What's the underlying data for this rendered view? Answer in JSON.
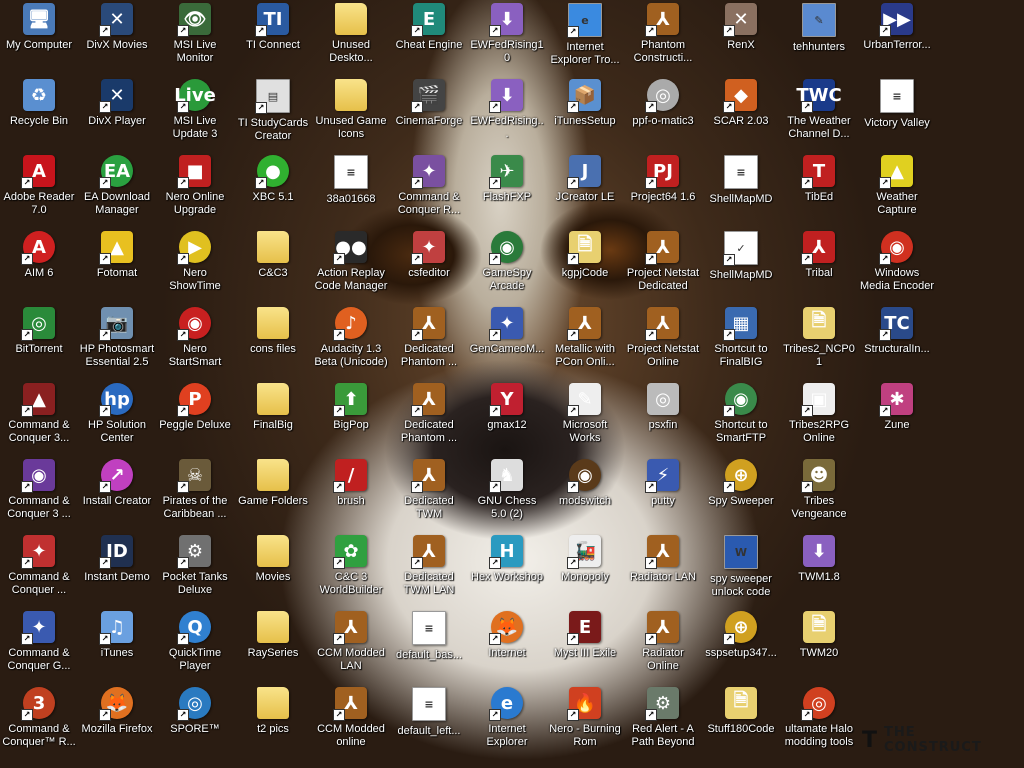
{
  "desktop": {
    "icons": [
      {
        "label": "My Computer",
        "glyph": "🖥",
        "bg": "#4a7ab8",
        "type": "app",
        "shortcut": false
      },
      {
        "label": "Recycle Bin",
        "glyph": "♻",
        "bg": "#5a8fd0",
        "type": "app",
        "shortcut": false
      },
      {
        "label": "Adobe Reader 7.0",
        "glyph": "A",
        "bg": "#c8141c",
        "type": "app",
        "shortcut": true
      },
      {
        "label": "AIM 6",
        "glyph": "A",
        "bg": "#d02020",
        "type": "round",
        "shortcut": true
      },
      {
        "label": "BitTorrent",
        "glyph": "◎",
        "bg": "#2a8a3a",
        "type": "app",
        "shortcut": true
      },
      {
        "label": "Command & Conquer 3...",
        "glyph": "▲",
        "bg": "#8a2020",
        "type": "app",
        "shortcut": true
      },
      {
        "label": "Command & Conquer 3 ...",
        "glyph": "◉",
        "bg": "#6a3a9a",
        "type": "app",
        "shortcut": true
      },
      {
        "label": "Command & Conquer ...",
        "glyph": "✦",
        "bg": "#c03030",
        "type": "app",
        "shortcut": true
      },
      {
        "label": "Command & Conquer G...",
        "glyph": "✦",
        "bg": "#3a5ab0",
        "type": "app",
        "shortcut": true
      },
      {
        "label": "Command & Conquer™ R...",
        "glyph": "3",
        "bg": "#c04020",
        "type": "round",
        "shortcut": true
      },
      {
        "label": "DivX Movies",
        "glyph": "✕",
        "bg": "#2a4a7a",
        "type": "app",
        "shortcut": true
      },
      {
        "label": "DivX Player",
        "glyph": "✕",
        "bg": "#1a3a6a",
        "type": "app",
        "shortcut": true
      },
      {
        "label": "EA Download Manager",
        "glyph": "EA",
        "bg": "#2aa040",
        "type": "round",
        "shortcut": true
      },
      {
        "label": "Fotomat",
        "glyph": "▲",
        "bg": "#e8c020",
        "type": "app",
        "shortcut": true
      },
      {
        "label": "HP Photosmart Essential 2.5",
        "glyph": "📷",
        "bg": "#7090b0",
        "type": "app",
        "shortcut": true
      },
      {
        "label": "HP Solution Center",
        "glyph": "hp",
        "bg": "#2a6ac0",
        "type": "round",
        "shortcut": true
      },
      {
        "label": "Install Creator",
        "glyph": "↗",
        "bg": "#c040c0",
        "type": "round",
        "shortcut": true
      },
      {
        "label": "Instant Demo",
        "glyph": "ID",
        "bg": "#203050",
        "type": "app",
        "shortcut": true
      },
      {
        "label": "iTunes",
        "glyph": "♫",
        "bg": "#6aa0e0",
        "type": "app",
        "shortcut": true
      },
      {
        "label": "Mozilla Firefox",
        "glyph": "🦊",
        "bg": "#e07020",
        "type": "round",
        "shortcut": true
      },
      {
        "label": "MSI Live Monitor",
        "glyph": "👁",
        "bg": "#3a6a3a",
        "type": "app",
        "shortcut": true
      },
      {
        "label": "MSI Live Update 3",
        "glyph": "Live",
        "bg": "#2a9a3a",
        "type": "round",
        "shortcut": true
      },
      {
        "label": "Nero Online Upgrade",
        "glyph": "■",
        "bg": "#c02020",
        "type": "app",
        "shortcut": true
      },
      {
        "label": "Nero ShowTime",
        "glyph": "▶",
        "bg": "#e0c020",
        "type": "round",
        "shortcut": true
      },
      {
        "label": "Nero StartSmart",
        "glyph": "◉",
        "bg": "#c82020",
        "type": "round",
        "shortcut": true
      },
      {
        "label": "Peggle Deluxe",
        "glyph": "P",
        "bg": "#e04020",
        "type": "round",
        "shortcut": true
      },
      {
        "label": "Pirates of the Caribbean ...",
        "glyph": "☠",
        "bg": "#6a5a3a",
        "type": "app",
        "shortcut": true
      },
      {
        "label": "Pocket Tanks Deluxe",
        "glyph": "⚙",
        "bg": "#707070",
        "type": "app",
        "shortcut": true
      },
      {
        "label": "QuickTime Player",
        "glyph": "Q",
        "bg": "#3080d0",
        "type": "round",
        "shortcut": true
      },
      {
        "label": "SPORE™",
        "glyph": "◎",
        "bg": "#2a7ac0",
        "type": "round",
        "shortcut": true
      },
      {
        "label": "TI Connect",
        "glyph": "TI",
        "bg": "#2a5aa0",
        "type": "app",
        "shortcut": true
      },
      {
        "label": "TI StudyCards Creator",
        "glyph": "▤",
        "bg": "#e0e0e0",
        "type": "doc",
        "shortcut": true
      },
      {
        "label": "XBC 5.1",
        "glyph": "●",
        "bg": "#30b030",
        "type": "round",
        "shortcut": true
      },
      {
        "label": "C&C3",
        "glyph": "",
        "bg": "",
        "type": "folder",
        "shortcut": false
      },
      {
        "label": "cons files",
        "glyph": "",
        "bg": "",
        "type": "folder",
        "shortcut": false
      },
      {
        "label": "FinalBig",
        "glyph": "",
        "bg": "",
        "type": "folder",
        "shortcut": false
      },
      {
        "label": "Game Folders",
        "glyph": "",
        "bg": "",
        "type": "folder",
        "shortcut": false
      },
      {
        "label": "Movies",
        "glyph": "",
        "bg": "",
        "type": "folder",
        "shortcut": false
      },
      {
        "label": "RaySeries",
        "glyph": "",
        "bg": "",
        "type": "folder",
        "shortcut": false
      },
      {
        "label": "t2 pics",
        "glyph": "",
        "bg": "",
        "type": "folder",
        "shortcut": false
      },
      {
        "label": "Unused Deskto...",
        "glyph": "",
        "bg": "",
        "type": "folder",
        "shortcut": false
      },
      {
        "label": "Unused Game Icons",
        "glyph": "",
        "bg": "",
        "type": "folder",
        "shortcut": false
      },
      {
        "label": "38a01668",
        "glyph": "≡",
        "bg": "#fff",
        "type": "doc",
        "shortcut": false
      },
      {
        "label": "Action Replay Code Manager",
        "glyph": "●●",
        "bg": "#2a2a2a",
        "type": "app",
        "shortcut": true
      },
      {
        "label": "Audacity 1.3 Beta (Unicode)",
        "glyph": "♪",
        "bg": "#e06020",
        "type": "round",
        "shortcut": true
      },
      {
        "label": "BigPop",
        "glyph": "⬆",
        "bg": "#3a9a3a",
        "type": "app",
        "shortcut": true
      },
      {
        "label": "brush",
        "glyph": "/",
        "bg": "#c02020",
        "type": "app",
        "shortcut": true
      },
      {
        "label": "C&C 3 WorldBuilder",
        "glyph": "✿",
        "bg": "#30a040",
        "type": "app",
        "shortcut": true
      },
      {
        "label": "CCM Modded LAN",
        "glyph": "⅄",
        "bg": "#a06020",
        "type": "app",
        "shortcut": true
      },
      {
        "label": "CCM Modded online",
        "glyph": "⅄",
        "bg": "#a06020",
        "type": "app",
        "shortcut": true
      },
      {
        "label": "Cheat Engine",
        "glyph": "E",
        "bg": "#208a7a",
        "type": "app",
        "shortcut": true
      },
      {
        "label": "CinemaForge",
        "glyph": "🎬",
        "bg": "#444",
        "type": "app",
        "shortcut": true
      },
      {
        "label": "Command & Conquer R...",
        "glyph": "✦",
        "bg": "#7a50a0",
        "type": "app",
        "shortcut": true
      },
      {
        "label": "csfeditor",
        "glyph": "✦",
        "bg": "#c04040",
        "type": "app",
        "shortcut": true
      },
      {
        "label": "Dedicated Phantom ...",
        "glyph": "⅄",
        "bg": "#a06020",
        "type": "app",
        "shortcut": true
      },
      {
        "label": "Dedicated Phantom ...",
        "glyph": "⅄",
        "bg": "#a06020",
        "type": "app",
        "shortcut": true
      },
      {
        "label": "Dedicated TWM",
        "glyph": "⅄",
        "bg": "#a06020",
        "type": "app",
        "shortcut": true
      },
      {
        "label": "Dedicated TWM LAN",
        "glyph": "⅄",
        "bg": "#a06020",
        "type": "app",
        "shortcut": true
      },
      {
        "label": "default_bas...",
        "glyph": "≡",
        "bg": "#fff",
        "type": "doc",
        "shortcut": false
      },
      {
        "label": "default_left...",
        "glyph": "≡",
        "bg": "#fff",
        "type": "doc",
        "shortcut": false
      },
      {
        "label": "EWFedRising10",
        "glyph": "⬇",
        "bg": "#8a60c0",
        "type": "app",
        "shortcut": true
      },
      {
        "label": "EWFedRising...",
        "glyph": "⬇",
        "bg": "#8a60c0",
        "type": "app",
        "shortcut": true
      },
      {
        "label": "FlashFXP",
        "glyph": "✈",
        "bg": "#3a8a4a",
        "type": "app",
        "shortcut": true
      },
      {
        "label": "GameSpy Arcade",
        "glyph": "◉",
        "bg": "#2a7a3a",
        "type": "round",
        "shortcut": true
      },
      {
        "label": "GenCameoM...",
        "glyph": "✦",
        "bg": "#3a5ab0",
        "type": "app",
        "shortcut": true
      },
      {
        "label": "gmax12",
        "glyph": "Y",
        "bg": "#c02030",
        "type": "app",
        "shortcut": true
      },
      {
        "label": "GNU Chess 5.0 (2)",
        "glyph": "♞",
        "bg": "#ddd",
        "type": "app",
        "shortcut": true
      },
      {
        "label": "Hex Workshop",
        "glyph": "H",
        "bg": "#2a9ac0",
        "type": "app",
        "shortcut": true
      },
      {
        "label": "Internet",
        "glyph": "🦊",
        "bg": "#e07020",
        "type": "round",
        "shortcut": true
      },
      {
        "label": "Internet Explorer",
        "glyph": "e",
        "bg": "#2a7ad0",
        "type": "round",
        "shortcut": true
      },
      {
        "label": "Internet Explorer Tro...",
        "glyph": "e",
        "bg": "#3a8ae0",
        "type": "doc",
        "shortcut": true
      },
      {
        "label": "iTunesSetup",
        "glyph": "📦",
        "bg": "#5a90d0",
        "type": "app",
        "shortcut": true
      },
      {
        "label": "JCreator LE",
        "glyph": "J",
        "bg": "#4a70b0",
        "type": "app",
        "shortcut": true
      },
      {
        "label": "kgpjCode",
        "glyph": "🗎",
        "bg": "#e8d070",
        "type": "app",
        "shortcut": true
      },
      {
        "label": "Metallic with PCon Onli...",
        "glyph": "⅄",
        "bg": "#a06020",
        "type": "app",
        "shortcut": true
      },
      {
        "label": "Microsoft Works",
        "glyph": "✎",
        "bg": "#eee",
        "type": "app",
        "shortcut": true
      },
      {
        "label": "modswitch",
        "glyph": "◉",
        "bg": "#5a3a1a",
        "type": "round",
        "shortcut": true
      },
      {
        "label": "Monopoly",
        "glyph": "🚂",
        "bg": "#eee",
        "type": "app",
        "shortcut": true
      },
      {
        "label": "Myst III Exile",
        "glyph": "E",
        "bg": "#7a1a1a",
        "type": "app",
        "shortcut": true
      },
      {
        "label": "Nero - Burning Rom",
        "glyph": "🔥",
        "bg": "#d04020",
        "type": "app",
        "shortcut": true
      },
      {
        "label": "Phantom Constructi...",
        "glyph": "⅄",
        "bg": "#a06020",
        "type": "app",
        "shortcut": true
      },
      {
        "label": "ppf-o-matic3",
        "glyph": "◎",
        "bg": "#aaa",
        "type": "round",
        "shortcut": true
      },
      {
        "label": "Project64 1.6",
        "glyph": "PJ",
        "bg": "#c02020",
        "type": "app",
        "shortcut": true
      },
      {
        "label": "Project Netstat Dedicated",
        "glyph": "⅄",
        "bg": "#a06020",
        "type": "app",
        "shortcut": true
      },
      {
        "label": "Project Netstat Online",
        "glyph": "⅄",
        "bg": "#a06020",
        "type": "app",
        "shortcut": true
      },
      {
        "label": "psxfin",
        "glyph": "◎",
        "bg": "#bbb",
        "type": "app",
        "shortcut": false
      },
      {
        "label": "putty",
        "glyph": "⚡",
        "bg": "#3a5ab0",
        "type": "app",
        "shortcut": true
      },
      {
        "label": "Radiator LAN",
        "glyph": "⅄",
        "bg": "#a06020",
        "type": "app",
        "shortcut": true
      },
      {
        "label": "Radiator Online",
        "glyph": "⅄",
        "bg": "#a06020",
        "type": "app",
        "shortcut": true
      },
      {
        "label": "Red Alert - A Path Beyond",
        "glyph": "⚙",
        "bg": "#6a7a6a",
        "type": "app",
        "shortcut": true
      },
      {
        "label": "RenX",
        "glyph": "✕",
        "bg": "#8a7060",
        "type": "app",
        "shortcut": true
      },
      {
        "label": "SCAR 2.03",
        "glyph": "◆",
        "bg": "#d06020",
        "type": "app",
        "shortcut": true
      },
      {
        "label": "ShellMapMD",
        "glyph": "≡",
        "bg": "#fff",
        "type": "doc",
        "shortcut": false
      },
      {
        "label": "ShellMapMD",
        "glyph": "✓",
        "bg": "#fff",
        "type": "doc",
        "shortcut": true
      },
      {
        "label": "Shortcut to FinalBIG",
        "glyph": "▦",
        "bg": "#3a6ab0",
        "type": "app",
        "shortcut": true
      },
      {
        "label": "Shortcut to SmartFTP",
        "glyph": "◉",
        "bg": "#3a8a4a",
        "type": "round",
        "shortcut": true
      },
      {
        "label": "Spy Sweeper",
        "glyph": "⊕",
        "bg": "#d0a020",
        "type": "round",
        "shortcut": true
      },
      {
        "label": "spy sweeper unlock code",
        "glyph": "W",
        "bg": "#2a5ab0",
        "type": "doc",
        "shortcut": false
      },
      {
        "label": "sspsetup347...",
        "glyph": "⊕",
        "bg": "#d0a020",
        "type": "round",
        "shortcut": true
      },
      {
        "label": "Stuff180Code",
        "glyph": "🗎",
        "bg": "#e8d070",
        "type": "app",
        "shortcut": false
      },
      {
        "label": "tehhunters",
        "glyph": "✎",
        "bg": "#5a8ad0",
        "type": "doc",
        "shortcut": false
      },
      {
        "label": "The Weather Channel D...",
        "glyph": "TWC",
        "bg": "#1a3a8a",
        "type": "app",
        "shortcut": true
      },
      {
        "label": "TibEd",
        "glyph": "T",
        "bg": "#c02020",
        "type": "app",
        "shortcut": true
      },
      {
        "label": "Tribal",
        "glyph": "⅄",
        "bg": "#c02020",
        "type": "app",
        "shortcut": true
      },
      {
        "label": "Tribes2_NCP01",
        "glyph": "🗎",
        "bg": "#e8d070",
        "type": "app",
        "shortcut": false
      },
      {
        "label": "Tribes2RPG Online",
        "glyph": "▣",
        "bg": "#eee",
        "type": "app",
        "shortcut": true
      },
      {
        "label": "Tribes Vengeance",
        "glyph": "☻",
        "bg": "#7a6a3a",
        "type": "app",
        "shortcut": true
      },
      {
        "label": "TWM1.8",
        "glyph": "⬇",
        "bg": "#8a60c0",
        "type": "app",
        "shortcut": false
      },
      {
        "label": "TWM20",
        "glyph": "🗎",
        "bg": "#e8d070",
        "type": "app",
        "shortcut": false
      },
      {
        "label": "ultamate Halo modding tools",
        "glyph": "◎",
        "bg": "#d04020",
        "type": "round",
        "shortcut": true
      },
      {
        "label": "UrbanTerror...",
        "glyph": "▶▶",
        "bg": "#2a3a8a",
        "type": "app",
        "shortcut": true
      },
      {
        "label": "Victory Valley",
        "glyph": "≡",
        "bg": "#fff",
        "type": "doc",
        "shortcut": false
      },
      {
        "label": "Weather Capture",
        "glyph": "▲",
        "bg": "#e0d020",
        "type": "app",
        "shortcut": true
      },
      {
        "label": "Windows Media Encoder",
        "glyph": "◉",
        "bg": "#d03020",
        "type": "round",
        "shortcut": true
      },
      {
        "label": "StructuralIn...",
        "glyph": "TC",
        "bg": "#2a4a8a",
        "type": "app",
        "shortcut": true
      },
      {
        "label": "Zune",
        "glyph": "✱",
        "bg": "#c04080",
        "type": "app",
        "shortcut": true
      }
    ]
  },
  "watermark": {
    "text": "THE CONSTRUCT",
    "mark": "T"
  }
}
